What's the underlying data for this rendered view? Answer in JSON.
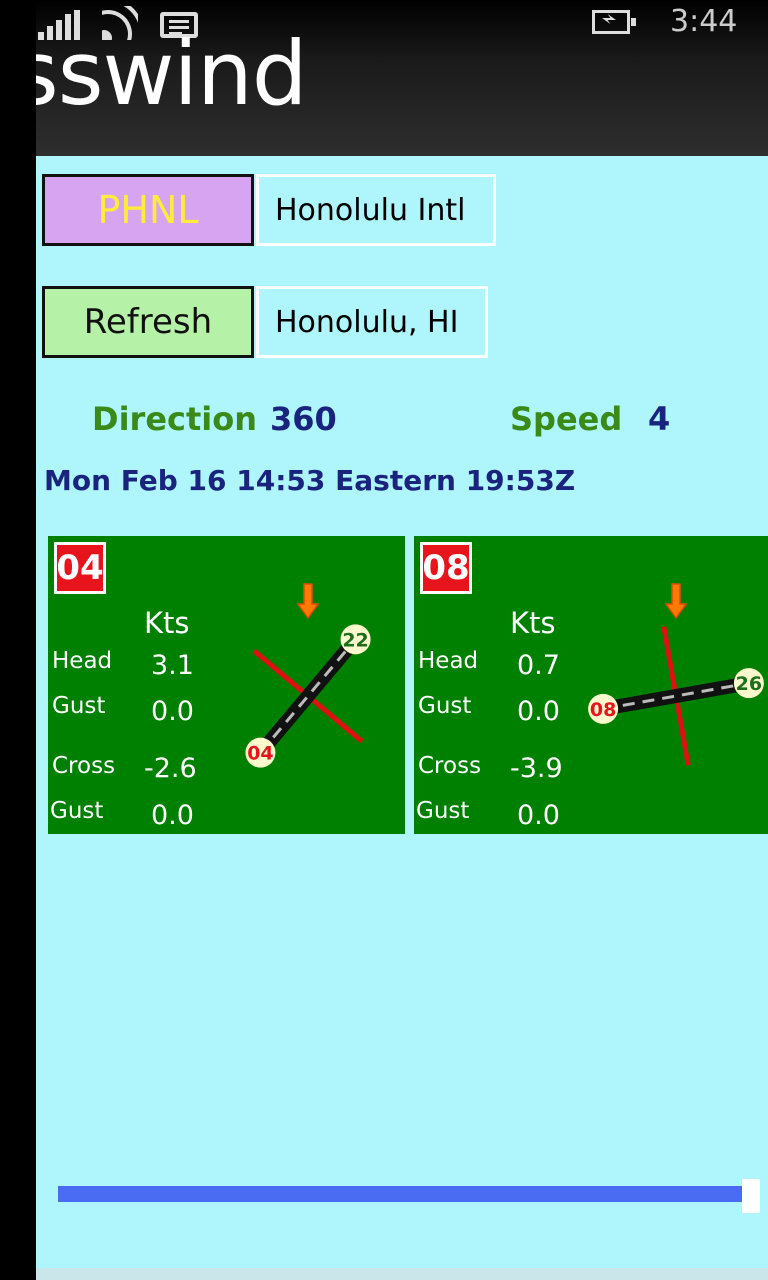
{
  "status_bar": {
    "time": "3:44",
    "icons": [
      "signal-icon",
      "wifi-icon",
      "message-icon",
      "battery-charging-icon"
    ]
  },
  "app": {
    "title": "osswind"
  },
  "airport": {
    "code": "PHNL",
    "name": "Honolulu Intl",
    "refresh_label": "Refresh",
    "city": "Honolulu, HI"
  },
  "wind": {
    "direction_label": "Direction",
    "direction_value": "360",
    "speed_label": "Speed",
    "speed_value": "4",
    "timestamp": "Mon Feb 16 14:53 Eastern  19:53Z"
  },
  "runways": [
    {
      "id": "04",
      "units": "Kts",
      "head_label": "Head",
      "head_value": "3.1",
      "head_gust_label": "Gust",
      "head_gust_value": "0.0",
      "cross_label": "Cross",
      "cross_value": "-2.6",
      "cross_gust_label": "Gust",
      "cross_gust_value": "0.0",
      "end_a": "04",
      "end_b": "22",
      "heading_deg": 40
    },
    {
      "id": "08",
      "units": "Kts",
      "head_label": "Head",
      "head_value": "0.7",
      "head_gust_label": "Gust",
      "head_gust_value": "0.0",
      "cross_label": "Cross",
      "cross_value": "-3.9",
      "cross_gust_label": "Gust",
      "cross_gust_value": "0.0",
      "end_a": "08",
      "end_b": "26",
      "heading_deg": 80
    }
  ],
  "slider": {
    "value_fraction": 1.0
  },
  "colors": {
    "background": "#aef6fb",
    "code_button": "#d7a4f2",
    "code_text": "#ffeb3b",
    "refresh_button": "#b5f1a6",
    "panel": "#008000",
    "badge": "#e8141c",
    "label_green": "#3a8a17",
    "value_navy": "#1a237e",
    "slider": "#4a6cf2",
    "wind_arrow": "#ff7a00",
    "cross_line": "#dd1111"
  }
}
